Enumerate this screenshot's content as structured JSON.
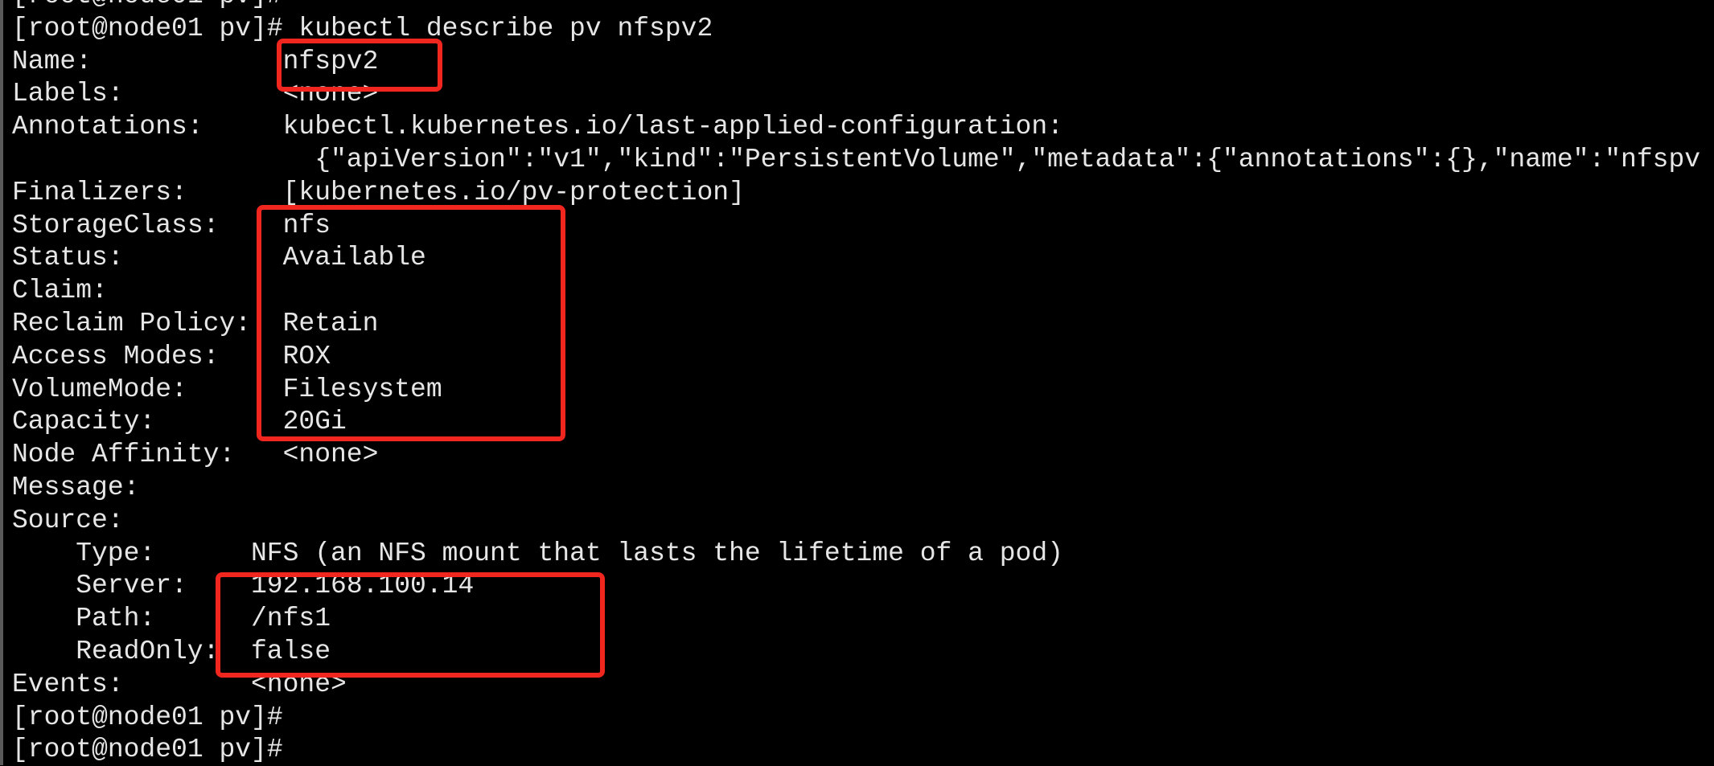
{
  "terminal": {
    "prompt": "[root@node01 pv]#",
    "command": "kubectl describe pv nfspv2",
    "fields": [
      {
        "label": "Name:",
        "value": "nfspv2"
      },
      {
        "label": "Labels:",
        "value": "<none>"
      },
      {
        "label": "Annotations:",
        "value": "kubectl.kubernetes.io/last-applied-configuration:"
      },
      {
        "label": "",
        "value": "{\"apiVersion\":\"v1\",\"kind\":\"PersistentVolume\",\"metadata\":{\"annotations\":{},\"name\":\"nfspv"
      },
      {
        "label": "Finalizers:",
        "value": "[kubernetes.io/pv-protection]"
      },
      {
        "label": "StorageClass:",
        "value": "nfs"
      },
      {
        "label": "Status:",
        "value": "Available"
      },
      {
        "label": "Claim:",
        "value": ""
      },
      {
        "label": "Reclaim Policy:",
        "value": "Retain"
      },
      {
        "label": "Access Modes:",
        "value": "ROX"
      },
      {
        "label": "VolumeMode:",
        "value": "Filesystem"
      },
      {
        "label": "Capacity:",
        "value": "20Gi"
      },
      {
        "label": "Node Affinity:",
        "value": "<none>"
      },
      {
        "label": "Message:",
        "value": ""
      },
      {
        "label": "Source:",
        "value": ""
      },
      {
        "label": "Type:",
        "value": "NFS (an NFS mount that lasts the lifetime of a pod)"
      },
      {
        "label": "Server:",
        "value": "192.168.100.14"
      },
      {
        "label": "Path:",
        "value": "/nfs1"
      },
      {
        "label": "ReadOnly:",
        "value": "false"
      },
      {
        "label": "Events:",
        "value": "<none>"
      }
    ]
  },
  "colors": {
    "background": "#000000",
    "text": "#e6e6e6",
    "highlight_box": "#f0261f"
  }
}
